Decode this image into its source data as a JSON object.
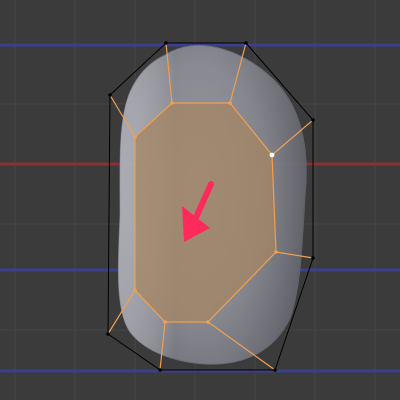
{
  "viewport": {
    "editor": "3d-viewport",
    "mode": "edit-mode",
    "shading": "solid-with-xray",
    "grid": true,
    "colors": {
      "background": "#3b3b3b",
      "grid_line": "#454545",
      "axis_red": "#8a3232",
      "axis_blue": "#3a3f8e",
      "mesh_surface": "#8f9099",
      "selected_face": "#a68463",
      "selected_edge": "#f0a050",
      "unselected_edge": "#000000",
      "active_vertex": "#ffffff",
      "annotation_arrow": "#ff2a5c"
    },
    "annotation_icon": "pointer-arrow-icon"
  }
}
